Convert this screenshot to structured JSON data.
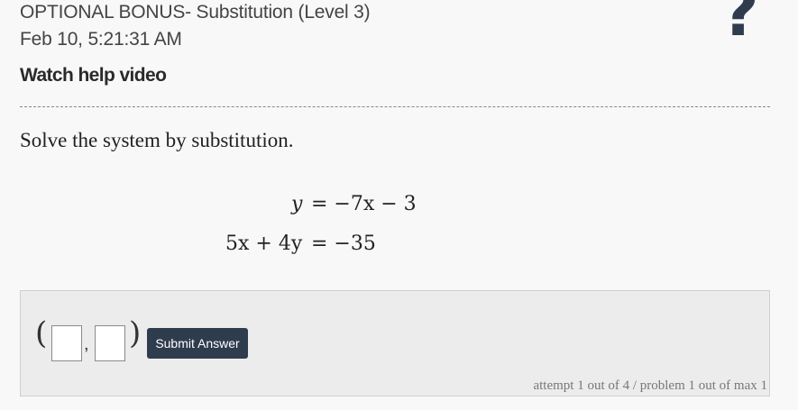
{
  "header": {
    "title": "OPTIONAL BONUS- Substitution (Level 3)",
    "date": "Feb 10, 5:21:31 AM",
    "help_link": "Watch help video",
    "help_icon": "question-mark-icon",
    "help_icon_glyph": "?"
  },
  "problem": {
    "instruction": "Solve the system by substitution.",
    "equations": [
      {
        "lhs": "y",
        "rhs": "= −7x − 3"
      },
      {
        "lhs": "5x + 4y",
        "rhs": "= −35"
      }
    ]
  },
  "answer": {
    "open_paren": "(",
    "comma": ",",
    "close_paren": ")",
    "x_value": "",
    "y_value": "",
    "submit_label": "Submit Answer",
    "attempt_text": "attempt 1 out of 4 / problem 1 out of max 1"
  },
  "colors": {
    "accent": "#2f3c4e",
    "background": "#f8f8f8",
    "answer_panel": "#ececec"
  }
}
